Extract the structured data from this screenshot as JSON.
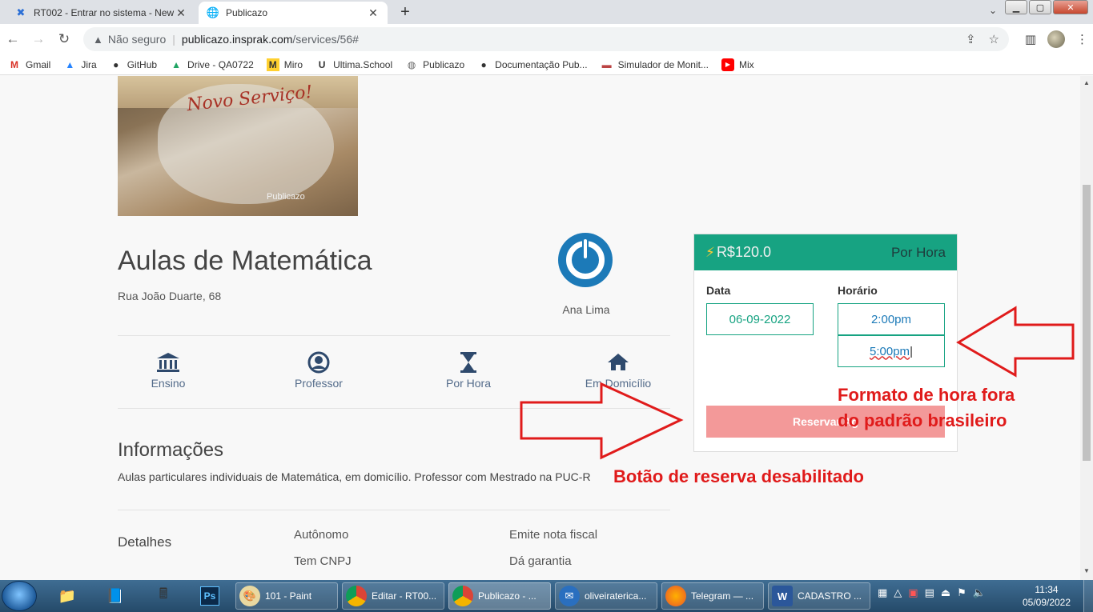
{
  "browser": {
    "tabs": [
      {
        "title": "RT002 - Entrar no sistema - New",
        "active": false
      },
      {
        "title": "Publicazo",
        "active": true
      }
    ],
    "address": {
      "security": "Não seguro",
      "host": "publicazo.insprak.com",
      "path": "/services/56#"
    },
    "bookmarks": [
      {
        "label": "Gmail",
        "icon": "gmail-icon"
      },
      {
        "label": "Jira",
        "icon": "jira-icon"
      },
      {
        "label": "GitHub",
        "icon": "github-icon"
      },
      {
        "label": "Drive - QA0722",
        "icon": "drive-icon"
      },
      {
        "label": "Miro",
        "icon": "miro-icon"
      },
      {
        "label": "Ultima.School",
        "icon": "ultima-icon"
      },
      {
        "label": "Publicazo",
        "icon": "globe-icon"
      },
      {
        "label": "Documentação Pub...",
        "icon": "github-icon"
      },
      {
        "label": "Simulador de Monit...",
        "icon": "simulator-icon"
      },
      {
        "label": "Mix",
        "icon": "youtube-icon"
      }
    ]
  },
  "service": {
    "cover_title": "Novo Serviço!",
    "cover_brand": "Publicazo",
    "title": "Aulas de Matemática",
    "address": "Rua João Duarte, 68",
    "provider": "Ana Lima",
    "features": [
      {
        "label": "Ensino",
        "icon": "bank-icon"
      },
      {
        "label": "Professor",
        "icon": "user-circle-icon"
      },
      {
        "label": "Por Hora",
        "icon": "hourglass-icon"
      },
      {
        "label": "Em Domicílio",
        "icon": "home-icon"
      }
    ],
    "info_heading": "Informações",
    "info_text": "Aulas particulares individuais de Matemática, em domicílio. Professor com Mestrado na PUC-R",
    "details_heading": "Detalhes",
    "details": [
      "Autônomo",
      "Emite nota fiscal",
      "Tem CNPJ",
      "Dá garantia"
    ]
  },
  "booking": {
    "price": "R$120.0",
    "unit": "Por Hora",
    "date_label": "Data",
    "date_value": "06-09-2022",
    "time_label": "Horário",
    "time_start": "2:00pm",
    "time_end": "5:00pm",
    "reserve_label": "Reservar Ag",
    "header_color": "#17a382",
    "button_color": "#f28e8e"
  },
  "annotations": {
    "time_note_line1": "Formato de hora fora",
    "time_note_line2": "do padrão brasileiro",
    "button_note": "Botão de reserva desabilitado",
    "color": "#e01b1b"
  },
  "taskbar": {
    "items": [
      {
        "label": "101 - Paint",
        "icon": "paint-icon"
      },
      {
        "label": "Editar - RT00...",
        "icon": "chrome-icon"
      },
      {
        "label": "Publicazo - ...",
        "icon": "chrome-icon"
      },
      {
        "label": "oliveiraterica...",
        "icon": "thunderbird-icon"
      },
      {
        "label": "Telegram — ...",
        "icon": "firefox-icon"
      },
      {
        "label": "CADASTRO ...",
        "icon": "word-icon"
      }
    ],
    "time": "11:34",
    "date": "05/09/2022"
  }
}
